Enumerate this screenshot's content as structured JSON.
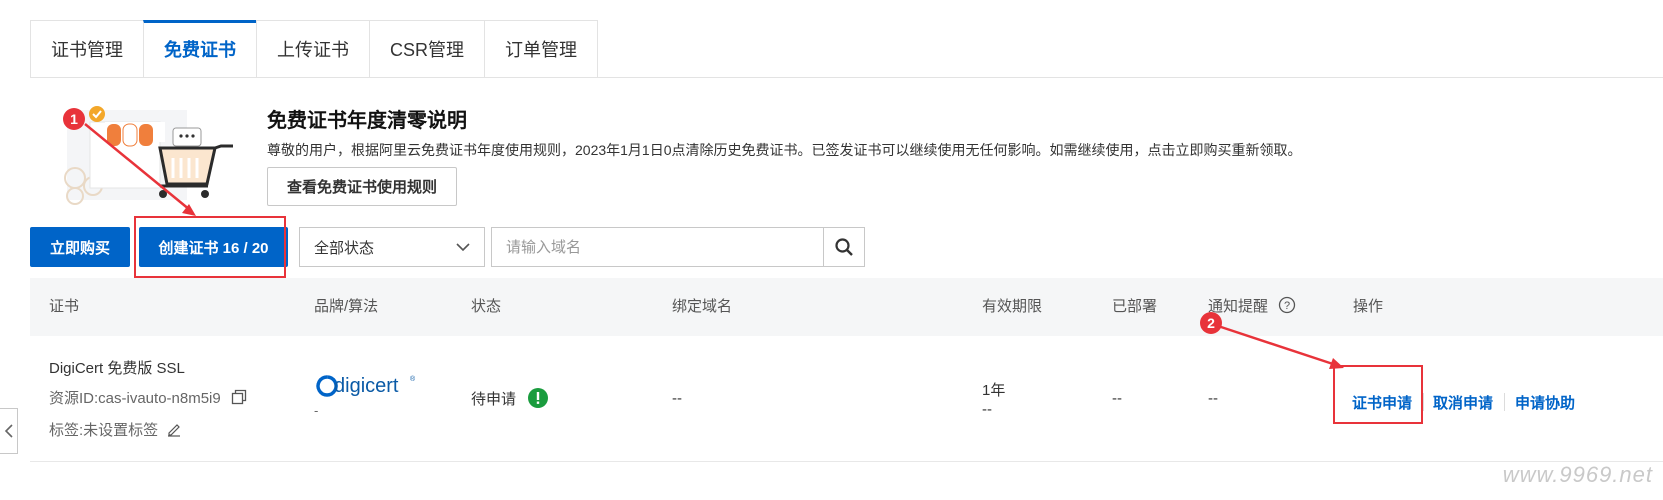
{
  "tabs": [
    {
      "label": "证书管理",
      "active": false
    },
    {
      "label": "免费证书",
      "active": true
    },
    {
      "label": "上传证书",
      "active": false
    },
    {
      "label": "CSR管理",
      "active": false
    },
    {
      "label": "订单管理",
      "active": false
    }
  ],
  "banner": {
    "title": "免费证书年度清零说明",
    "description": "尊敬的用户，根据阿里云免费证书年度使用规则，2023年1月1日0点清除历史免费证书。已签发证书可以继续使用无任何影响。如需继续使用，点击立即购买重新领取。",
    "rules_button": "查看免费证书使用规则"
  },
  "toolbar": {
    "buy_button": "立即购买",
    "create_button": "创建证书 16 / 20",
    "status_select": "全部状态",
    "search_placeholder": "请输入域名"
  },
  "table": {
    "headers": {
      "cert": "证书",
      "brand": "品牌/算法",
      "status": "状态",
      "domain": "绑定域名",
      "validity": "有效期限",
      "deployed": "已部署",
      "notify": "通知提醒",
      "actions": "操作"
    },
    "row": {
      "name": "DigiCert 免费版 SSL",
      "resource_id": "资源ID:cas-ivauto-n8m5i9",
      "tags": "标签:未设置标签",
      "brand_logo": "digicert",
      "brand_sub": "-",
      "status": "待申请",
      "domain": "--",
      "validity_period": "1年",
      "validity_date": "--",
      "deployed": "--",
      "notify": "--",
      "action_apply": "证书申请",
      "action_cancel": "取消申请",
      "action_assist": "申请协助"
    }
  },
  "annotations": {
    "marker1": "1",
    "marker2": "2",
    "highlight_color": "#e8333a"
  },
  "watermark": "www.9969.net",
  "accent_color": "#0064c8"
}
